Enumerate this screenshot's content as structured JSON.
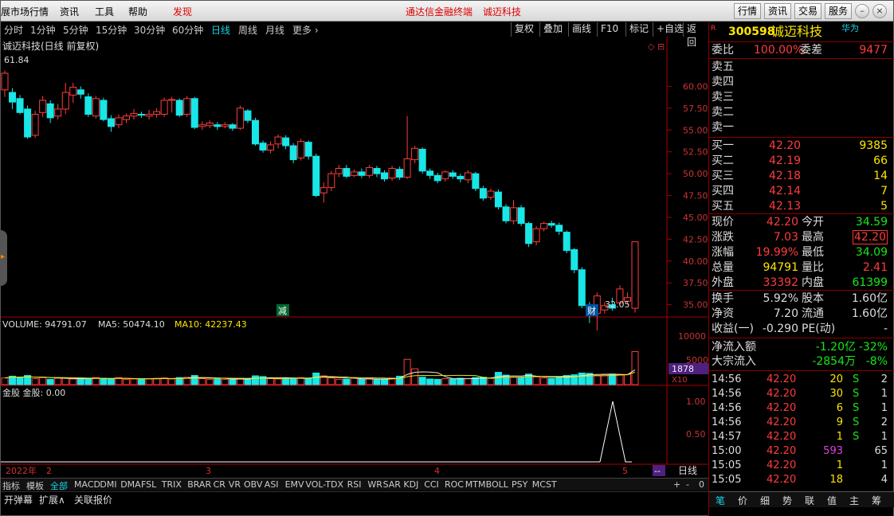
{
  "menu": {
    "items": [
      "展市场行情",
      "资讯",
      "工具",
      "帮助"
    ],
    "discover": "发现",
    "center_title": "通达信金融终端",
    "center_stock": "诚迈科技",
    "right_buttons": [
      "行情",
      "资讯",
      "交易",
      "服务"
    ]
  },
  "periods": {
    "items": [
      "分时",
      "1分钟",
      "5分钟",
      "15分钟",
      "30分钟",
      "60分钟",
      "日线",
      "周线",
      "月线",
      "更多 ›"
    ],
    "active": "日线",
    "tools": [
      "复权",
      "叠加",
      "画线",
      "F10",
      "标记",
      "+自选",
      "返回"
    ]
  },
  "chart": {
    "title": "诚迈科技(日线 前复权)",
    "high_label": "61.84",
    "low_label": "32.05",
    "marker_jian": "减",
    "marker_cai": "财",
    "price_ticks": [
      "60.00",
      "57.50",
      "55.00",
      "52.50",
      "50.00",
      "47.50",
      "45.00",
      "42.50",
      "40.00",
      "37.50",
      "35.00"
    ],
    "volume_label": "VOLUME: 94791.07",
    "ma5_label": "MA5: 50474.10",
    "ma10_label": "MA10: 42237.43",
    "vol_ticks": [
      "10000",
      "5000"
    ],
    "vol_scale": "X10",
    "vol_box": "1878",
    "jin_label": "金股  金股: 0.00",
    "jin_ticks": [
      "1.00",
      "0.50"
    ],
    "date_labels": [
      "2022年",
      "2",
      "3",
      "4",
      "5"
    ],
    "period_tag": "日线",
    "dash_tag": "--"
  },
  "indicators": {
    "items": [
      "指标",
      "模板",
      "全部",
      "MACD",
      "DMI",
      "DMA",
      "FSL",
      "TRIX",
      "BRAR",
      "CR",
      "VR",
      "OBV",
      "ASI",
      "EMV",
      "VOL-TDX",
      "RSI",
      "WR",
      "SAR",
      "KDJ",
      "CCI",
      "ROC",
      "MTM",
      "BOLL",
      "PSY",
      "MCST"
    ],
    "active": "全部",
    "zoom": [
      "+",
      "-",
      "0"
    ]
  },
  "status": {
    "items": [
      "开弹幕",
      "扩展∧",
      "关联报价"
    ]
  },
  "quote": {
    "flag": "R",
    "code": "300598",
    "name": "诚迈科技",
    "tag": "华为",
    "weibi_label": "委比",
    "weibi": "100.00%",
    "weicha_label": "委差",
    "weicha": "9477",
    "sell": [
      {
        "label": "卖五"
      },
      {
        "label": "卖四"
      },
      {
        "label": "卖三"
      },
      {
        "label": "卖二"
      },
      {
        "label": "卖一"
      }
    ],
    "buy": [
      {
        "label": "买一",
        "price": "42.20",
        "vol": "9385"
      },
      {
        "label": "买二",
        "price": "42.19",
        "vol": "66"
      },
      {
        "label": "买三",
        "price": "42.18",
        "vol": "14"
      },
      {
        "label": "买四",
        "price": "42.14",
        "vol": "7"
      },
      {
        "label": "买五",
        "price": "42.13",
        "vol": "5"
      }
    ],
    "stats": [
      {
        "l1": "现价",
        "v1": "42.20",
        "c1": "red",
        "l2": "今开",
        "v2": "34.59",
        "c2": "grn"
      },
      {
        "l1": "涨跌",
        "v1": "7.03",
        "c1": "red",
        "l2": "最高",
        "v2": "42.20",
        "c2": "red"
      },
      {
        "l1": "涨幅",
        "v1": "19.99%",
        "c1": "red",
        "l2": "最低",
        "v2": "34.09",
        "c2": "grn"
      },
      {
        "l1": "总量",
        "v1": "94791",
        "c1": "yel",
        "l2": "量比",
        "v2": "2.41",
        "c2": "red"
      },
      {
        "l1": "外盘",
        "v1": "33392",
        "c1": "red",
        "l2": "内盘",
        "v2": "61399",
        "c2": "grn"
      }
    ],
    "stats2": [
      {
        "l1": "换手",
        "v1": "5.92%",
        "c1": "wht",
        "l2": "股本",
        "v2": "1.60亿",
        "c2": "wht"
      },
      {
        "l1": "净资",
        "v1": "7.20",
        "c1": "wht",
        "l2": "流通",
        "v2": "1.60亿",
        "c2": "wht"
      },
      {
        "l1": "收益(一)",
        "v1": "-0.290",
        "c1": "wht",
        "l2": "PE(动)",
        "v2": "-",
        "c2": "wht"
      }
    ],
    "flow": [
      {
        "label": "净流入额",
        "v1": "-1.20亿",
        "v2": "-32%"
      },
      {
        "label": "大宗流入",
        "v1": "-2854万",
        "v2": "-8%"
      }
    ],
    "ticks": [
      {
        "t": "14:56",
        "p": "42.20",
        "v": "20",
        "s": "S",
        "n": "2"
      },
      {
        "t": "14:56",
        "p": "42.20",
        "v": "30",
        "s": "S",
        "n": "1"
      },
      {
        "t": "14:56",
        "p": "42.20",
        "v": "6",
        "s": "S",
        "n": "1"
      },
      {
        "t": "14:56",
        "p": "42.20",
        "v": "9",
        "s": "S",
        "n": "2"
      },
      {
        "t": "14:57",
        "p": "42.20",
        "v": "1",
        "s": "S",
        "n": "1"
      },
      {
        "t": "15:00",
        "p": "42.20",
        "v": "593",
        "s": "",
        "n": "65"
      },
      {
        "t": "15:05",
        "p": "42.20",
        "v": "1",
        "s": "",
        "n": "1"
      },
      {
        "t": "15:05",
        "p": "42.20",
        "v": "18",
        "s": "",
        "n": "4"
      }
    ],
    "tabs": [
      "笔",
      "价",
      "细",
      "势",
      "联",
      "值",
      "主",
      "筹"
    ]
  },
  "candles": [
    [
      59.6,
      61.5,
      58.8,
      61.8
    ],
    [
      59.3,
      58.2,
      57.4,
      59.8
    ],
    [
      58.6,
      57.0,
      56.8,
      59.0
    ],
    [
      57.4,
      54.2,
      54.0,
      57.8
    ],
    [
      54.4,
      56.8,
      54.1,
      57.2
    ],
    [
      57.0,
      58.4,
      56.5,
      58.9
    ],
    [
      58.0,
      56.4,
      55.8,
      58.4
    ],
    [
      56.6,
      57.4,
      56.2,
      58.0
    ],
    [
      57.4,
      59.3,
      56.8,
      60.4
    ],
    [
      59.0,
      59.9,
      58.1,
      60.4
    ],
    [
      59.6,
      59.1,
      58.6,
      60.0
    ],
    [
      58.8,
      56.8,
      56.5,
      59.2
    ],
    [
      56.6,
      58.6,
      56.3,
      58.9
    ],
    [
      58.4,
      56.2,
      56.0,
      58.7
    ],
    [
      56.3,
      55.4,
      54.8,
      56.7
    ],
    [
      55.6,
      56.4,
      55.2,
      56.8
    ],
    [
      56.2,
      56.6,
      55.8,
      56.9
    ],
    [
      56.6,
      56.9,
      56.2,
      57.4
    ],
    [
      56.8,
      56.7,
      56.4,
      57.1
    ],
    [
      56.6,
      56.8,
      56.2,
      57.3
    ],
    [
      56.8,
      57.1,
      56.4,
      57.5
    ],
    [
      56.8,
      58.4,
      56.5,
      58.7
    ],
    [
      58.4,
      58.5,
      57.0,
      58.8
    ],
    [
      58.4,
      56.7,
      56.5,
      58.6
    ],
    [
      56.8,
      58.6,
      56.5,
      58.9
    ],
    [
      58.6,
      55.3,
      55.1,
      58.8
    ],
    [
      55.4,
      55.6,
      55.0,
      56.0
    ],
    [
      55.5,
      55.8,
      55.2,
      56.1
    ],
    [
      55.6,
      55.4,
      55.0,
      55.9
    ],
    [
      55.4,
      55.6,
      55.2,
      55.9
    ],
    [
      55.6,
      55.2,
      54.9,
      55.8
    ],
    [
      55.2,
      57.5,
      55.0,
      57.8
    ],
    [
      57.2,
      56.1,
      55.8,
      57.4
    ],
    [
      56.1,
      53.4,
      53.2,
      56.4
    ],
    [
      53.5,
      52.7,
      52.4,
      53.8
    ],
    [
      52.7,
      53.3,
      52.3,
      53.7
    ],
    [
      53.4,
      54.2,
      52.9,
      54.5
    ],
    [
      54.1,
      53.2,
      52.8,
      54.4
    ],
    [
      53.2,
      51.6,
      51.2,
      53.5
    ],
    [
      51.8,
      53.7,
      51.5,
      54.0
    ],
    [
      53.6,
      52.0,
      51.6,
      53.8
    ],
    [
      52.0,
      47.5,
      47.3,
      52.3
    ],
    [
      47.8,
      48.4,
      46.7,
      49.0
    ],
    [
      48.4,
      50.0,
      48.0,
      50.3
    ],
    [
      50.0,
      50.6,
      49.6,
      51.0
    ],
    [
      50.6,
      49.7,
      49.5,
      51.0
    ],
    [
      49.8,
      50.2,
      49.6,
      50.5
    ],
    [
      50.2,
      49.8,
      49.5,
      50.6
    ],
    [
      49.8,
      50.7,
      49.5,
      51.0
    ],
    [
      50.6,
      50.0,
      49.6,
      50.9
    ],
    [
      50.1,
      49.4,
      49.1,
      50.4
    ],
    [
      49.5,
      50.6,
      49.2,
      50.9
    ],
    [
      50.5,
      49.6,
      49.3,
      50.8
    ],
    [
      49.6,
      51.7,
      49.4,
      56.6
    ],
    [
      51.6,
      52.9,
      51.2,
      53.2
    ],
    [
      52.8,
      50.3,
      50.0,
      53.0
    ],
    [
      50.3,
      49.8,
      49.4,
      50.6
    ],
    [
      49.8,
      49.2,
      48.9,
      50.1
    ],
    [
      49.4,
      50.2,
      49.1,
      50.4
    ],
    [
      50.1,
      49.7,
      49.4,
      50.4
    ],
    [
      49.7,
      49.4,
      49.0,
      50.0
    ],
    [
      49.3,
      50.1,
      48.9,
      50.4
    ],
    [
      50.0,
      48.3,
      48.0,
      50.2
    ],
    [
      48.3,
      47.2,
      46.9,
      48.6
    ],
    [
      47.3,
      48.0,
      47.0,
      48.3
    ],
    [
      47.9,
      46.2,
      45.9,
      48.2
    ],
    [
      46.2,
      44.6,
      44.3,
      46.5
    ],
    [
      44.6,
      46.1,
      44.2,
      47.0
    ],
    [
      46.1,
      44.3,
      44.0,
      46.4
    ],
    [
      44.3,
      42.0,
      41.6,
      44.5
    ],
    [
      42.2,
      43.7,
      41.8,
      44.0
    ],
    [
      43.7,
      44.3,
      43.4,
      44.5
    ],
    [
      44.3,
      44.1,
      43.8,
      44.6
    ],
    [
      44.1,
      43.4,
      43.0,
      44.4
    ],
    [
      43.3,
      41.2,
      40.9,
      43.5
    ],
    [
      41.3,
      39.0,
      38.6,
      41.5
    ],
    [
      39.0,
      34.9,
      34.6,
      39.3
    ],
    [
      35.0,
      34.2,
      32.9,
      35.3
    ],
    [
      34.0,
      36.0,
      32.05,
      36.4
    ],
    [
      34.4,
      34.9,
      34.0,
      35.3
    ],
    [
      35.0,
      34.6,
      34.3,
      35.8
    ],
    [
      35.2,
      36.8,
      35.0,
      37.2
    ],
    [
      35.4,
      35.8,
      35.0,
      36.4
    ],
    [
      34.59,
      42.2,
      34.09,
      42.2
    ]
  ],
  "volumes": [
    1.9,
    2.4,
    2.1,
    2.6,
    1.7,
    2.0,
    1.5,
    1.8,
    1.9,
    1.6,
    1.6,
    1.7,
    2.0,
    1.8,
    1.6,
    2.0,
    1.5,
    1.6,
    1.7,
    1.6,
    1.8,
    1.9,
    1.6,
    2.0,
    2.1,
    2.6,
    1.7,
    1.5,
    1.6,
    1.5,
    1.6,
    1.8,
    1.5,
    2.5,
    2.3,
    1.7,
    1.6,
    1.8,
    1.9,
    2.0,
    1.7,
    3.3,
    2.5,
    1.9,
    1.5,
    1.6,
    1.8,
    1.5,
    1.7,
    1.4,
    1.6,
    1.9,
    2.4,
    7.2,
    4.5,
    2.1,
    1.6,
    1.5,
    1.7,
    1.6,
    1.8,
    1.7,
    2.0,
    2.1,
    1.9,
    3.5,
    2.7,
    2.1,
    2.0,
    3.0,
    2.2,
    1.9,
    1.8,
    2.1,
    2.6,
    2.8,
    3.3,
    3.2,
    2.6,
    2.8,
    3.0,
    2.9,
    2.9,
    9.4
  ]
}
